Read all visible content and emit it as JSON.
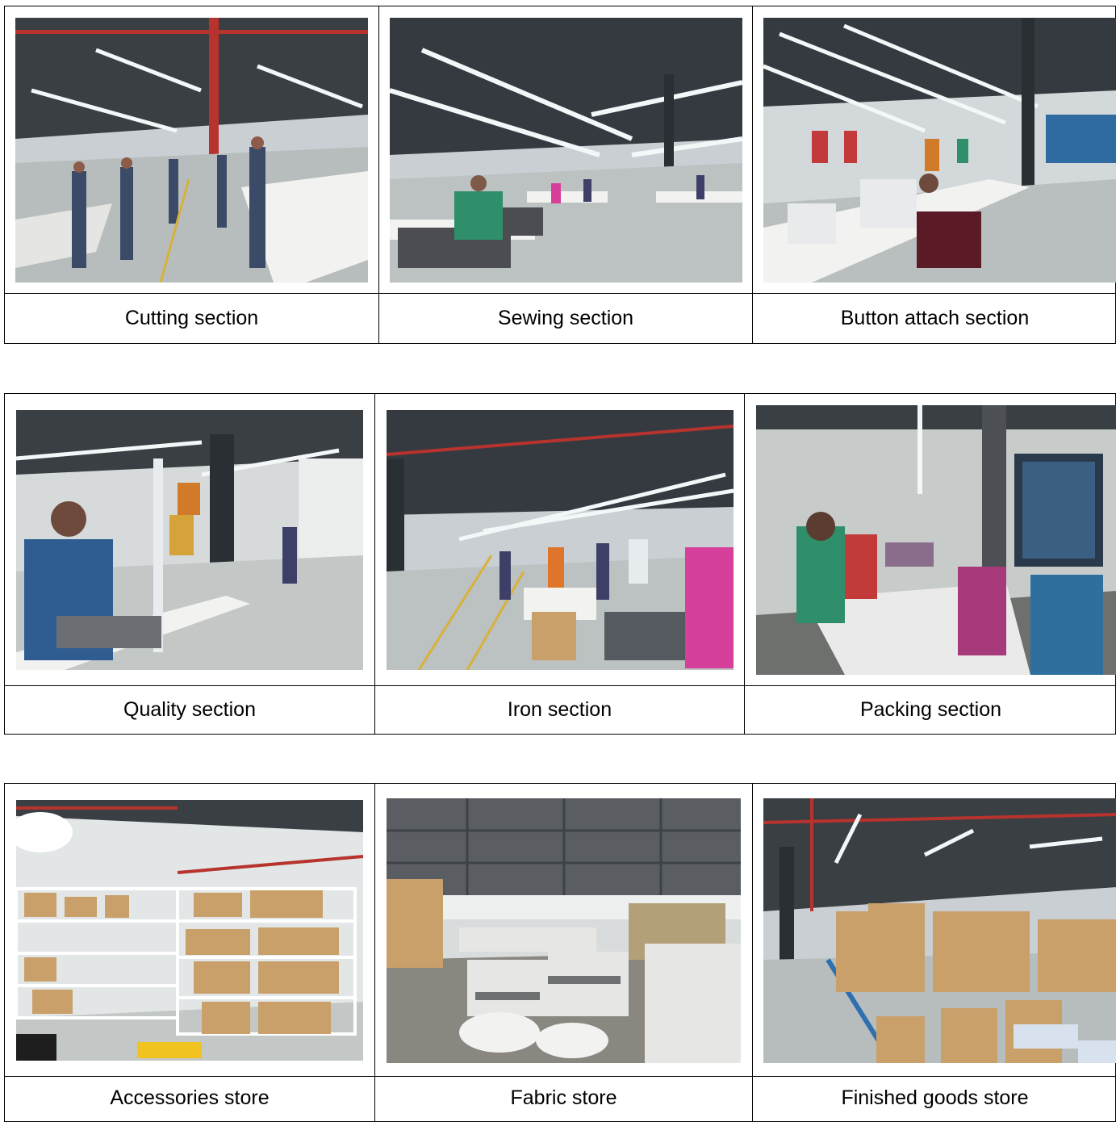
{
  "tables": [
    {
      "captions": [
        "Cutting section",
        "Sewing section",
        "Button attach section"
      ]
    },
    {
      "captions": [
        "Quality section",
        "Iron section",
        "Packing section"
      ]
    },
    {
      "captions": [
        "Accessories store",
        "Fabric store",
        "Finished goods store"
      ]
    }
  ],
  "colors": {
    "ceiling": "#3a3f44",
    "wall": "#c9cfd2",
    "floor": "#b7bdbc",
    "light": "#f4f7f8",
    "pipe": "#b8332e",
    "worker_green": "#2f8f6a",
    "worker_pink": "#d6409a",
    "carton": "#c9a06a",
    "fabric": "#e6e6e4",
    "table": "#f2f2f0"
  }
}
